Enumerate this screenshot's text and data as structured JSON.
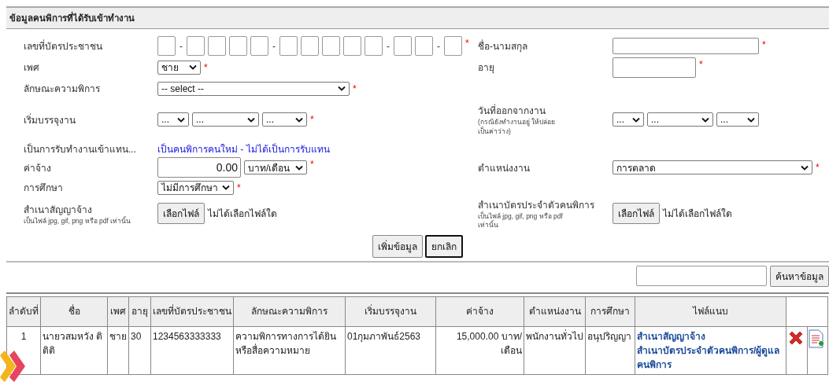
{
  "section_title": "ข้อมูลคนพิการที่ได้รับเข้าทำงาน",
  "form_rows": [
    {
      "left": {
        "label": "เลขที่บัตรประชาชน",
        "required_mark": "*",
        "controls": [
          {
            "kind": "digits",
            "groups": [
              {
                "boxes": [
                  {
                    "kind": "digit"
                  }
                ]
              },
              {
                "separator": "-",
                "boxes": [
                  {
                    "kind": "digit"
                  },
                  {
                    "kind": "digit"
                  },
                  {
                    "kind": "digit"
                  },
                  {
                    "kind": "digit"
                  }
                ]
              },
              {
                "separator": "-",
                "boxes": [
                  {
                    "kind": "digit"
                  },
                  {
                    "kind": "digit"
                  },
                  {
                    "kind": "digit"
                  },
                  {
                    "kind": "digit"
                  },
                  {
                    "kind": "digit"
                  }
                ]
              },
              {
                "separator": "-",
                "boxes": [
                  {
                    "kind": "digit"
                  },
                  {
                    "kind": "digit"
                  }
                ]
              },
              {
                "separator": "-",
                "boxes": [
                  {
                    "kind": "digit"
                  }
                ]
              }
            ]
          }
        ]
      },
      "right": {
        "label": "ชื่อ-นามสกุล",
        "required_mark": "*",
        "controls": [
          {
            "kind": "input"
          }
        ]
      }
    },
    {
      "left": {
        "label": "เพศ",
        "required_mark": "*",
        "controls": [
          {
            "kind": "select",
            "value": "ชาย"
          }
        ]
      },
      "right": {
        "label": "อายุ",
        "required_mark": "*",
        "controls": [
          {
            "kind": "input"
          }
        ]
      }
    },
    {
      "left": {
        "label": "ลักษณะความพิการ",
        "required_mark": "*",
        "controls": [
          {
            "kind": "select",
            "value": "-- select --"
          }
        ]
      }
    },
    {
      "left": {
        "label": "เริ่มบรรจุงาน",
        "required_mark": "*",
        "controls": [
          {
            "kind": "select",
            "value": "..."
          },
          {
            "kind": "select",
            "value": "..."
          },
          {
            "kind": "select",
            "value": "..."
          }
        ]
      },
      "right": {
        "label": "วันที่ออกจากงาน",
        "note": "(กรณียังทำงานอยู่ ให้ปล่อยเป็นค่าว่าง)",
        "controls": [
          {
            "kind": "select",
            "value": "..."
          },
          {
            "kind": "select",
            "value": "..."
          },
          {
            "kind": "select",
            "value": "..."
          }
        ]
      }
    },
    {
      "left": {
        "label": "เป็นการรับทำงานเข้าแทน...",
        "controls": [
          {
            "kind": "link",
            "value": "เป็นคนพิการคนใหม่ - ไม่ได้เป็นการรับแทน"
          }
        ]
      }
    },
    {
      "left": {
        "label": "ค่าจ้าง",
        "required_mark": "*",
        "controls": [
          {
            "kind": "number_input",
            "value": "0.00"
          },
          {
            "kind": "select",
            "value": "บาท/เดือน"
          }
        ]
      },
      "right": {
        "label": "ตำแหน่งงาน",
        "required_mark": "*",
        "controls": [
          {
            "kind": "select",
            "value": "การตลาด"
          }
        ]
      }
    },
    {
      "left": {
        "label": "การศึกษา",
        "required_mark": "*",
        "controls": [
          {
            "kind": "select",
            "value": "ไม่มีการศึกษา"
          }
        ]
      }
    },
    {
      "left": {
        "label": "สำเนาสัญญาจ้าง",
        "note": "เป็นไฟล์ jpg, gif, png หรือ pdf เท่านั้น",
        "controls": [
          {
            "kind": "file",
            "button": "เลือกไฟล์",
            "value": "ไม่ได้เลือกไฟล์ใด"
          }
        ]
      },
      "right": {
        "label": "สำเนาบัตรประจำตัวคนพิการ",
        "note": "เป็นไฟล์ jpg, gif, png หรือ pdf เท่านั้น",
        "controls": [
          {
            "kind": "file",
            "button": "เลือกไฟล์",
            "value": "ไม่ได้เลือกไฟล์ใด"
          }
        ]
      }
    }
  ],
  "form_buttons": [
    {
      "label": "เพิ่มข้อมูล",
      "selected": false
    },
    {
      "label": "ยกเลิก",
      "selected": true
    }
  ],
  "search": {
    "button": "ค้นหาข้อมูล"
  },
  "table": {
    "columns": [
      "ลำดับที่",
      "ชื่อ",
      "เพศ",
      "อายุ",
      "เลขที่บัตรประชาชน",
      "ลักษณะความพิการ",
      "เริ่มบรรจุงาน",
      "ค่าจ้าง",
      "ตำแหน่งงาน",
      "การศึกษา",
      "ไฟล์แนบ"
    ],
    "rows": [
      {
        "cells": [
          "1",
          "นายวสมหวัง ติติติ",
          "ชาย",
          "30",
          "1234563333333",
          "ความพิการทางการได้ยินหรือสื่อความหมาย",
          "01กุมภาพันธ์2563",
          "15,000.00 บาท/เดือน",
          "พนักงานทั่วไป",
          "อนุปริญญา"
        ],
        "attachments": [
          "สำเนาสัญญาจ้าง",
          "สำเนาบัตรประจำตัวคนพิการ/ผู้ดูแลคนพิการ"
        ],
        "actions": [
          {
            "kind": "delete"
          },
          {
            "kind": "add_document"
          }
        ]
      }
    ]
  }
}
